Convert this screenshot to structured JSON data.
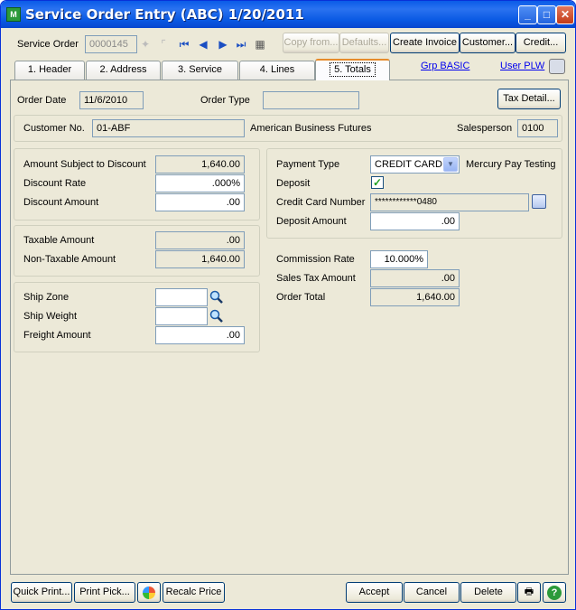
{
  "window": {
    "title": "Service Order Entry (ABC) 1/20/2011",
    "icon_text": "M"
  },
  "toolbar": {
    "service_order_label": "Service Order",
    "service_order_value": "0000145",
    "copy_from": "Copy from...",
    "defaults": "Defaults...",
    "create_invoice": "Create Invoice",
    "customer": "Customer...",
    "credit": "Credit..."
  },
  "tabs": [
    {
      "label": "1. Header"
    },
    {
      "label": "2. Address"
    },
    {
      "label": "3. Service Items"
    },
    {
      "label": "4. Lines"
    },
    {
      "label": "5. Totals"
    }
  ],
  "links": {
    "grp": "Grp BASIC",
    "user": "User PLW"
  },
  "header": {
    "order_date_label": "Order Date",
    "order_date": "11/6/2010",
    "order_type_label": "Order Type",
    "order_type": "",
    "tax_detail": "Tax Detail...",
    "customer_no_label": "Customer No.",
    "customer_no": "01-ABF",
    "customer_name": "American Business Futures",
    "salesperson_label": "Salesperson",
    "salesperson": "0100"
  },
  "discount": {
    "amount_subject_label": "Amount Subject to Discount",
    "amount_subject": "1,640.00",
    "rate_label": "Discount Rate",
    "rate": ".000%",
    "amount_label": "Discount Amount",
    "amount": ".00"
  },
  "tax": {
    "taxable_label": "Taxable Amount",
    "taxable": ".00",
    "nontaxable_label": "Non-Taxable Amount",
    "nontaxable": "1,640.00"
  },
  "ship": {
    "zone_label": "Ship Zone",
    "zone": "",
    "weight_label": "Ship Weight",
    "weight": "",
    "freight_label": "Freight Amount",
    "freight": ".00"
  },
  "payment": {
    "type_label": "Payment Type",
    "type": "CREDIT CARD",
    "processor": "Mercury Pay Testing",
    "deposit_label": "Deposit",
    "deposit_checked": true,
    "cc_label": "Credit Card Number",
    "cc": "************0480",
    "deposit_amount_label": "Deposit Amount",
    "deposit_amount": ".00"
  },
  "totals": {
    "commission_label": "Commission Rate",
    "commission": "10.000%",
    "sales_tax_label": "Sales Tax Amount",
    "sales_tax": ".00",
    "order_total_label": "Order Total",
    "order_total": "1,640.00"
  },
  "footer": {
    "quick_print": "Quick Print...",
    "print_pick": "Print Pick...",
    "recalc": "Recalc Price",
    "accept": "Accept",
    "cancel": "Cancel",
    "delete": "Delete"
  }
}
